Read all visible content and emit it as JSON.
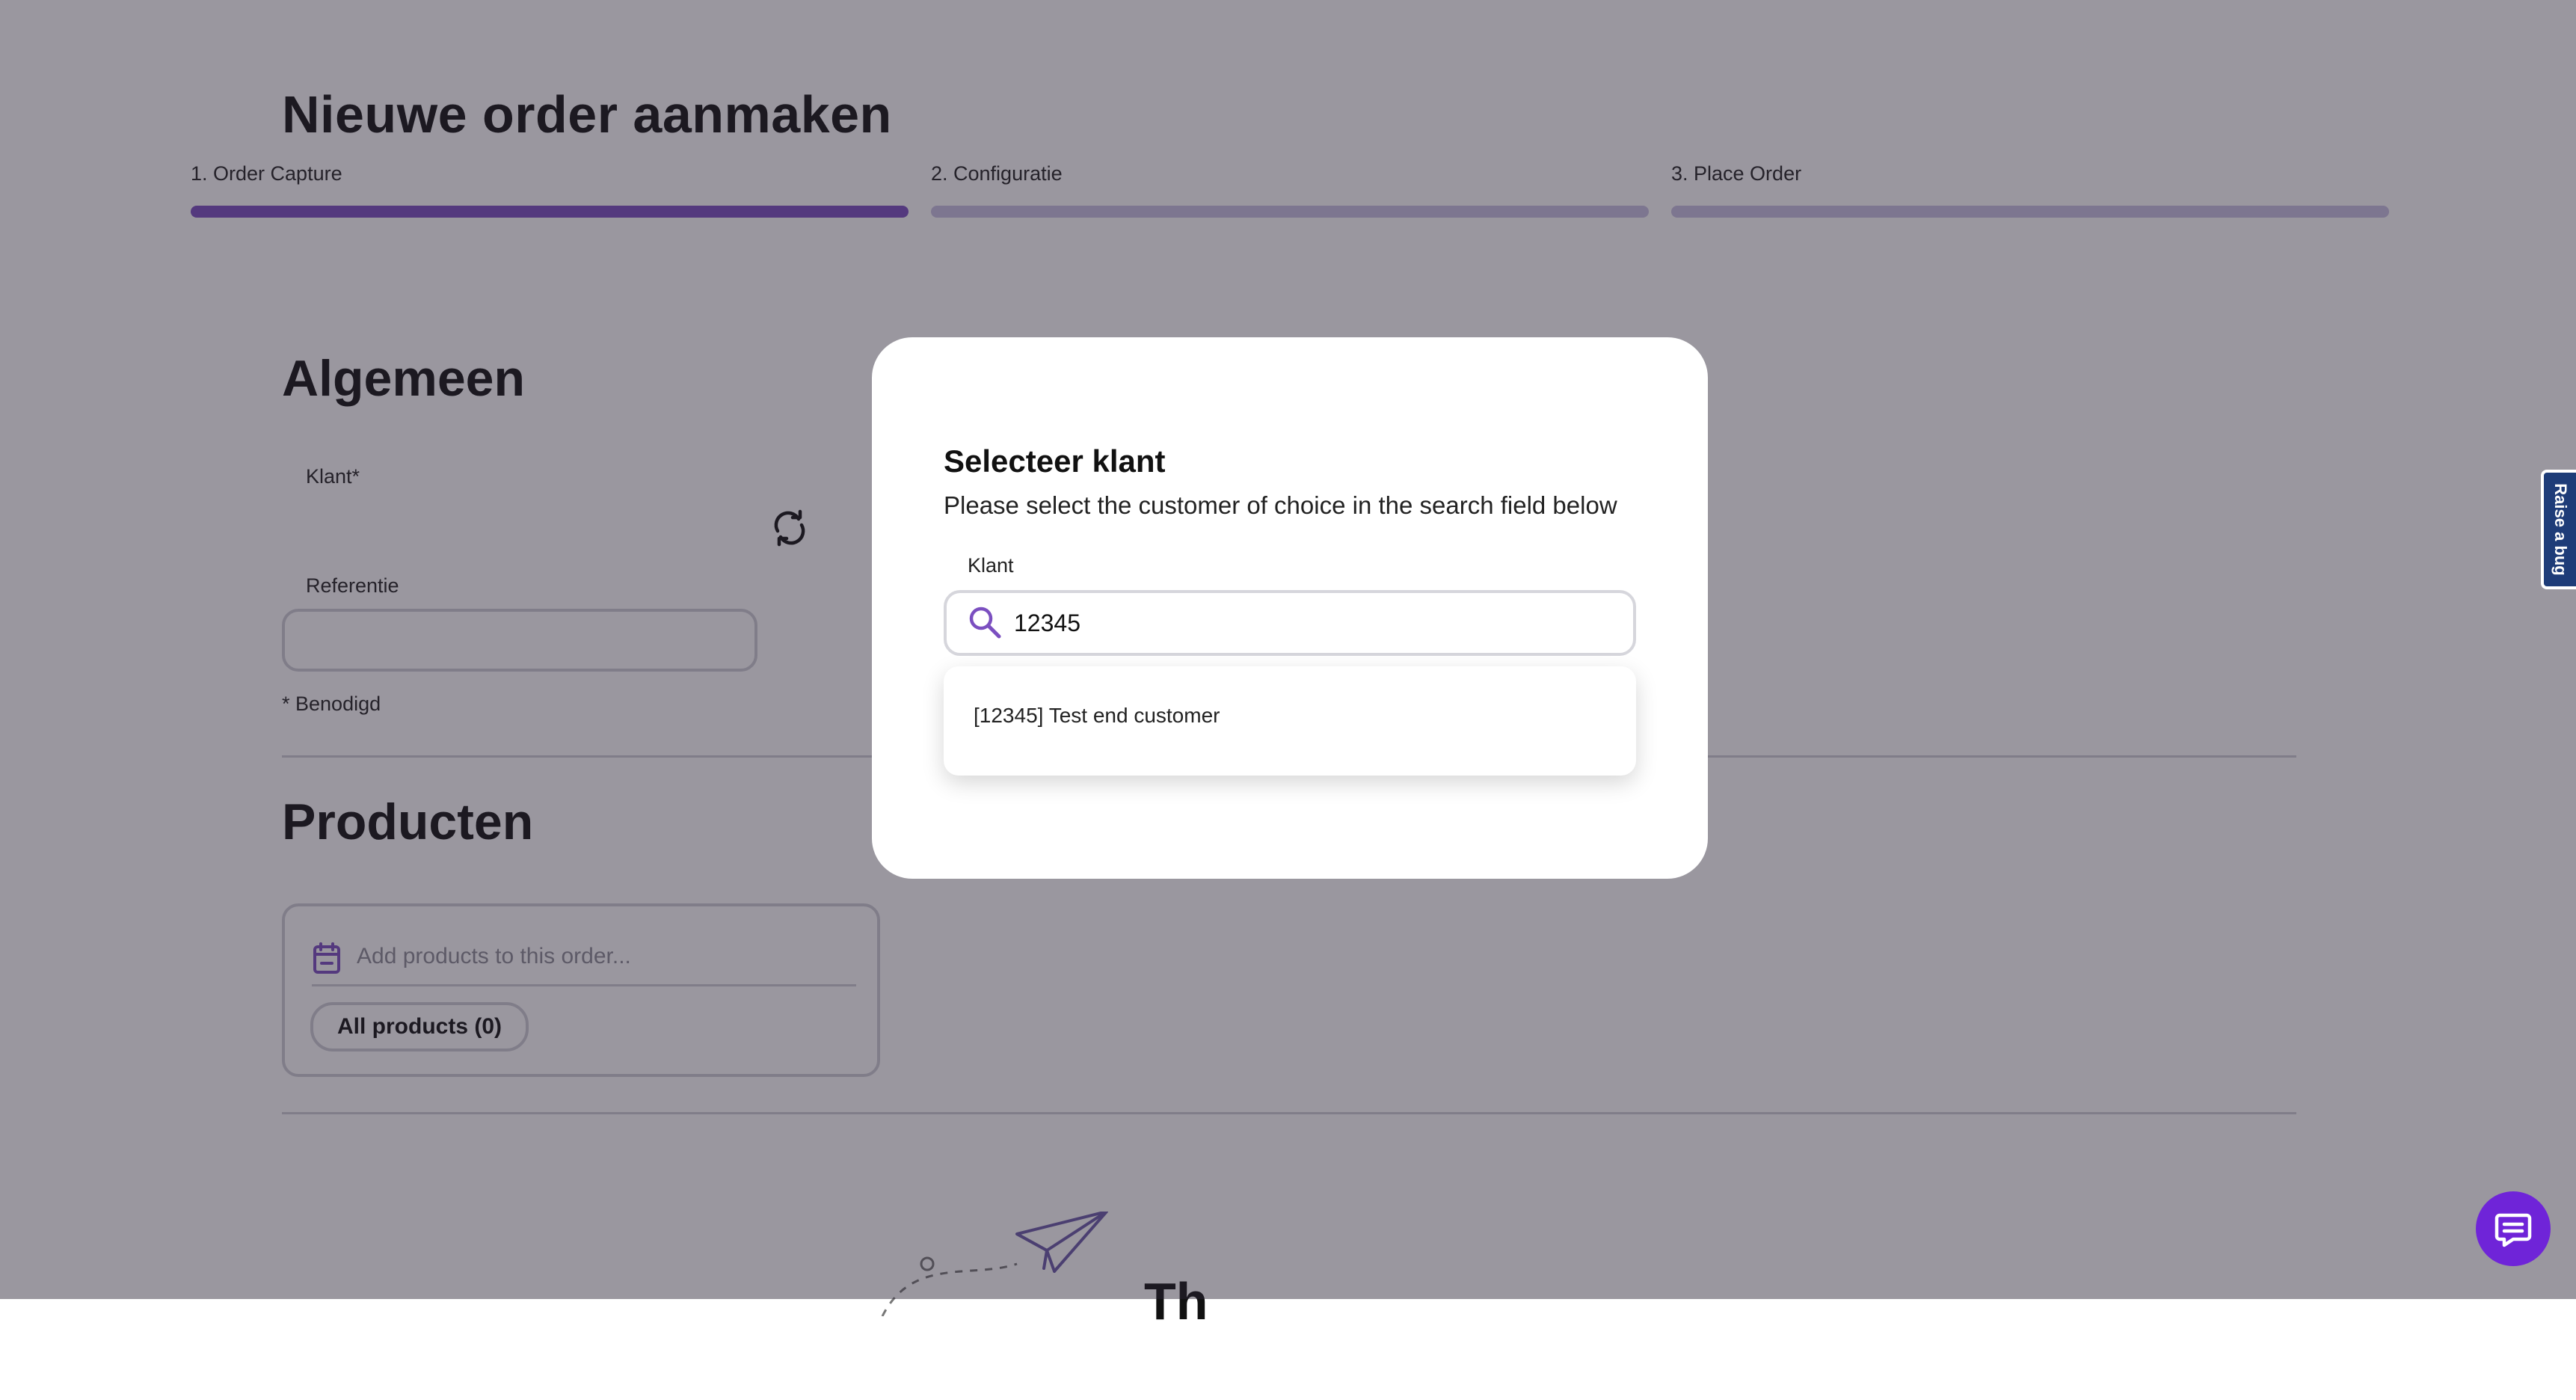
{
  "header": {
    "title": "Nieuwe order aanmaken",
    "steps": [
      {
        "label": "1. Order Capture",
        "active": true
      },
      {
        "label": "2. Configuratie",
        "active": false
      },
      {
        "label": "3. Place Order",
        "active": false
      }
    ]
  },
  "general": {
    "heading": "Algemeen",
    "customer_label": "Klant*",
    "reference_label": "Referentie",
    "reference_value": "",
    "required_note": "* Benodigd"
  },
  "products": {
    "heading": "Producten",
    "search_placeholder": "Add products to this order...",
    "chip_label": "All products (0)"
  },
  "empty_state": {
    "title_partial": "Th"
  },
  "modal": {
    "title": "Selecteer klant",
    "description": "Please select the customer of choice in the search field below",
    "field_label": "Klant",
    "search_value": "12345",
    "options": [
      "[12345] Test end customer"
    ]
  },
  "side_tab": {
    "label": "Raise a bug"
  },
  "colors": {
    "accent": "#7b4fc0",
    "step_inactive": "#c9c0e2",
    "overlay": "rgba(40,33,52,0.47)",
    "bug_tab": "#1e3c78",
    "chat": "#6f24d8"
  },
  "icons": {
    "refresh": "refresh-icon",
    "calendar": "calendar-icon",
    "search": "search-icon",
    "paper_plane": "paper-plane-icon",
    "chat": "chat-icon"
  }
}
